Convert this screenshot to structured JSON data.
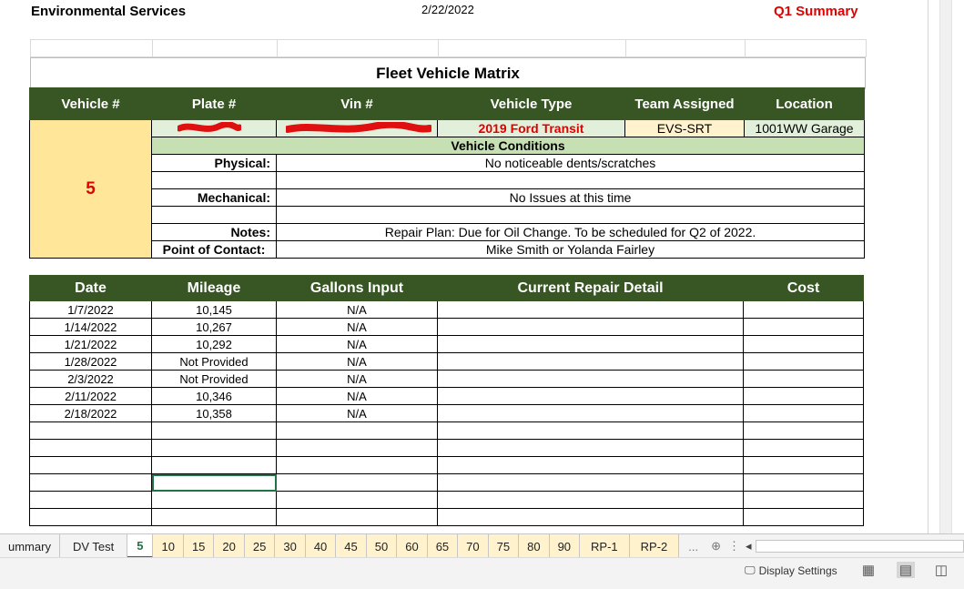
{
  "header": {
    "left": "Environmental Services",
    "date": "2/22/2022",
    "right": "Q1 Summary"
  },
  "title": "Fleet Vehicle Matrix",
  "vehicle_headers": [
    "Vehicle #",
    "Plate #",
    "Vin #",
    "Vehicle Type",
    "Team Assigned",
    "Location"
  ],
  "vehicle": {
    "number": "5",
    "plate": "",
    "vin": "",
    "type": "2019 Ford Transit",
    "team": "EVS-SRT",
    "location": "1001WW Garage"
  },
  "conditions": {
    "heading": "Vehicle Conditions",
    "physical_label": "Physical:",
    "physical_value": "No noticeable dents/scratches",
    "mechanical_label": "Mechanical:",
    "mechanical_value": "No Issues at this time",
    "notes_label": "Notes:",
    "notes_value": "Repair Plan: Due for Oil Change. To be scheduled for Q2 of 2022.",
    "contact_label": "Point of Contact:",
    "contact_value": "Mike Smith or Yolanda Fairley"
  },
  "log_headers": [
    "Date",
    "Mileage",
    "Gallons Input",
    "Current Repair Detail",
    "Cost"
  ],
  "log_rows": [
    {
      "date": "1/7/2022",
      "mileage": "10,145",
      "gallons": "N/A"
    },
    {
      "date": "1/14/2022",
      "mileage": "10,267",
      "gallons": "N/A"
    },
    {
      "date": "1/21/2022",
      "mileage": "10,292",
      "gallons": "N/A"
    },
    {
      "date": "1/28/2022",
      "mileage": "Not Provided",
      "gallons": "N/A"
    },
    {
      "date": "2/3/2022",
      "mileage": "Not Provided",
      "gallons": "N/A"
    },
    {
      "date": "2/11/2022",
      "mileage": "10,346",
      "gallons": "N/A"
    },
    {
      "date": "2/18/2022",
      "mileage": "10,358",
      "gallons": "N/A"
    }
  ],
  "tabs": [
    "ummary",
    "DV Test",
    "5",
    "10",
    "15",
    "20",
    "25",
    "30",
    "40",
    "45",
    "50",
    "60",
    "65",
    "70",
    "75",
    "80",
    "90",
    "RP-1",
    "RP-2"
  ],
  "tab_more": "...",
  "status": {
    "display_settings": "Display Settings"
  },
  "icons": [
    "display-settings-icon",
    "normal-view-icon",
    "page-layout-icon",
    "page-break-icon",
    "add-sheet-icon"
  ]
}
